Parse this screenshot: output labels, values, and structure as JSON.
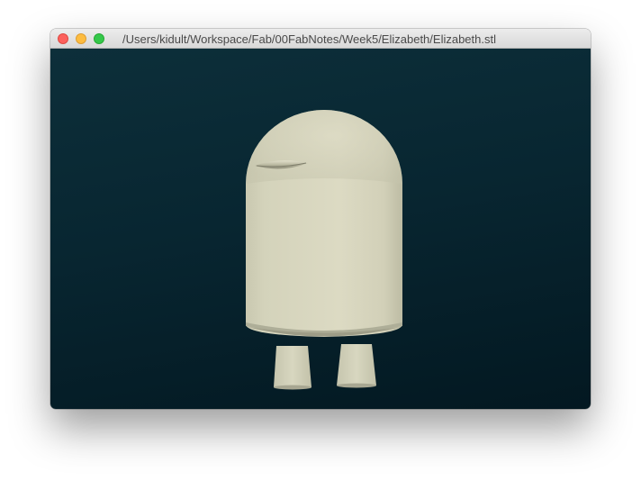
{
  "window": {
    "title": "/Users/kidult/Workspace/Fab/00FabNotes/Week5/Elizabeth/Elizabeth.stl"
  },
  "controls": {
    "close": "close-icon",
    "minimize": "minimize-icon",
    "zoom": "zoom-icon"
  },
  "colors": {
    "close": "#fc605c",
    "minimize": "#fdbc40",
    "zoom": "#34c84a",
    "viewport_top": "#0d2f3a",
    "viewport_bottom": "#031821",
    "model": "#d6d5be"
  }
}
